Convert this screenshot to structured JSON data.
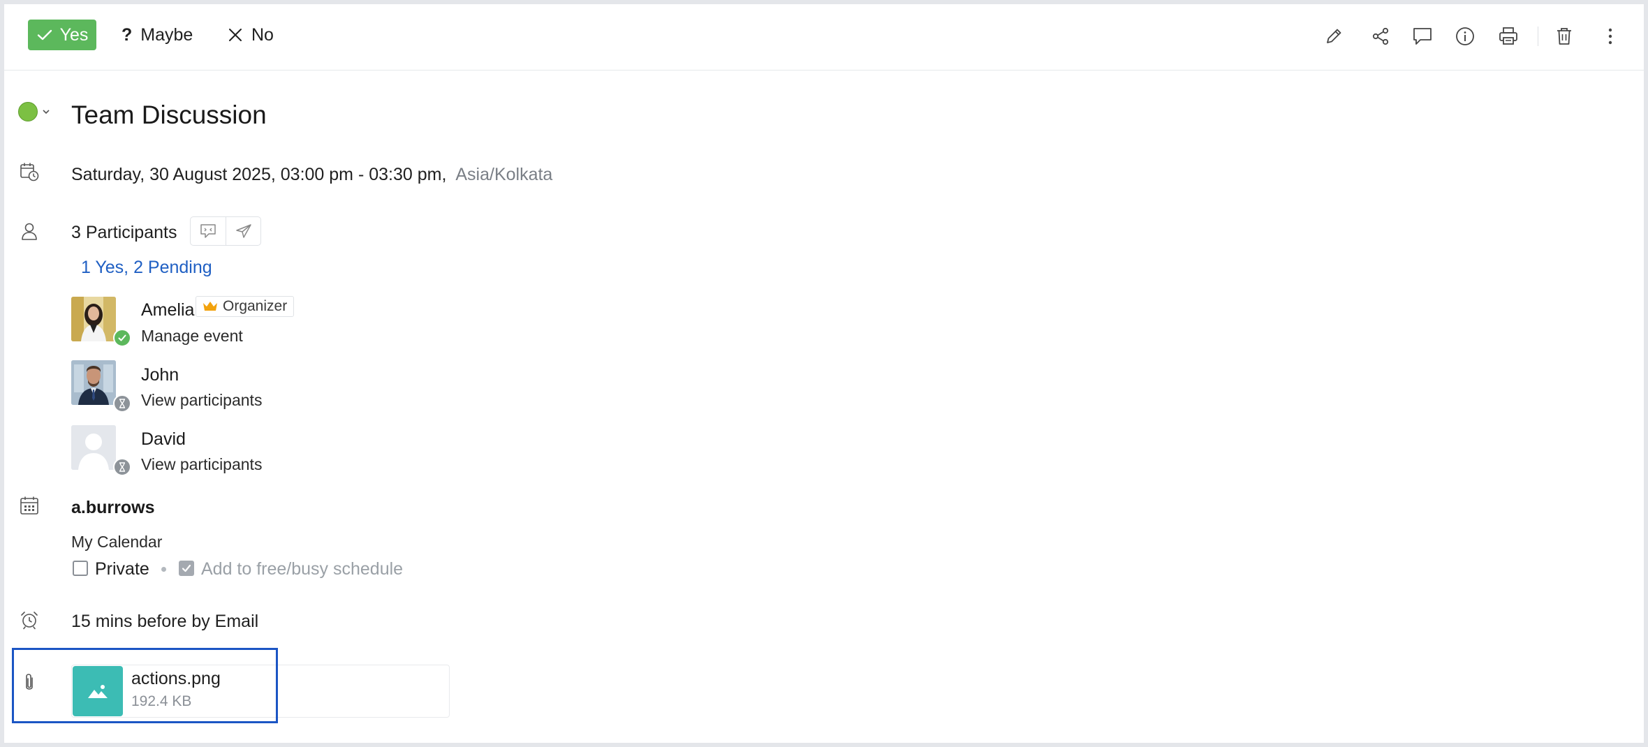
{
  "toolbar": {
    "rsvp_yes": "Yes",
    "rsvp_maybe": "Maybe",
    "rsvp_no": "No",
    "actions": [
      "pencil-icon",
      "share-icon",
      "comment-icon",
      "info-icon",
      "printer-icon",
      "trash-icon",
      "more-vertical-icon"
    ]
  },
  "event": {
    "status_color": "#7cc043",
    "title": "Team Discussion",
    "date": "Saturday, 30 August 2025,",
    "time_range": "03:00 pm  - 03:30 pm,",
    "timezone": "Asia/Kolkata"
  },
  "participants": {
    "count_label": "3 Participants",
    "summary": "1 Yes, 2 Pending",
    "list": [
      {
        "name": "Amelia",
        "role_badge": "Organizer",
        "action": "Manage event",
        "status": "accepted"
      },
      {
        "name": "John",
        "action": "View participants",
        "status": "pending"
      },
      {
        "name": "David",
        "action": "View participants",
        "status": "pending"
      }
    ]
  },
  "calendar": {
    "owner": "a.burrows",
    "name": "My Calendar",
    "private_label": "Private",
    "private_checked": false,
    "freebusy_label": "Add to free/busy schedule",
    "freebusy_checked": true
  },
  "reminder": {
    "text": "15 mins before by Email"
  },
  "attachment": {
    "file_name": "actions.png",
    "file_size": "192.4 KB"
  },
  "colors": {
    "accept_green": "#5cb85c",
    "link_blue": "#1f5fc3",
    "attachment_teal": "#3cbcb4",
    "highlight_blue": "#1b55c4"
  }
}
